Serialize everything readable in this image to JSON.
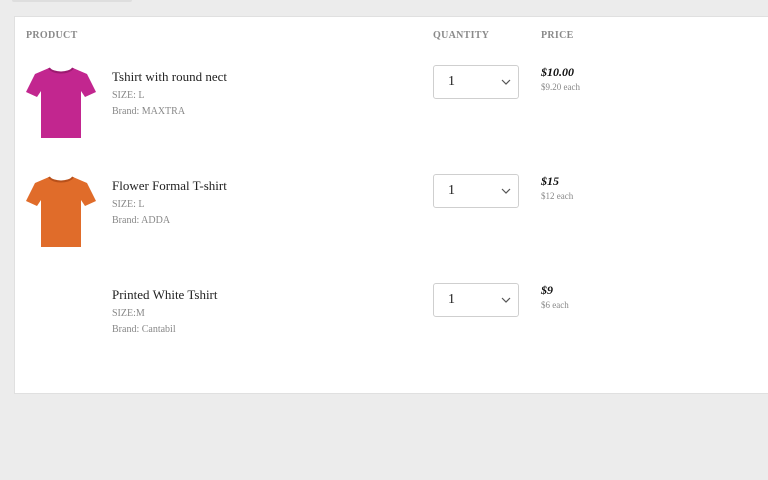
{
  "headers": {
    "product": "PRODUCT",
    "quantity": "QUANTITY",
    "price": "PRICE"
  },
  "items": [
    {
      "name": "Tshirt with round nect",
      "size": "SIZE: L",
      "brand": "Brand: MAXTRA",
      "quantity": "1",
      "price": "$10.00",
      "each": "$9.20 each",
      "color": "#c2268f",
      "image_icon": "tshirt-icon"
    },
    {
      "name": "Flower Formal T-shirt",
      "size": "SIZE: L",
      "brand": "Brand: ADDA",
      "quantity": "1",
      "price": "$15",
      "each": "$12 each",
      "color": "#e06c2a",
      "image_icon": "tshirt-icon"
    },
    {
      "name": "Printed White Tshirt",
      "size": "SIZE:M",
      "brand": "Brand: Cantabil",
      "quantity": "1",
      "price": "$9",
      "each": "$6 each",
      "color": "#ffffff",
      "image_icon": "tshirt-icon"
    }
  ]
}
